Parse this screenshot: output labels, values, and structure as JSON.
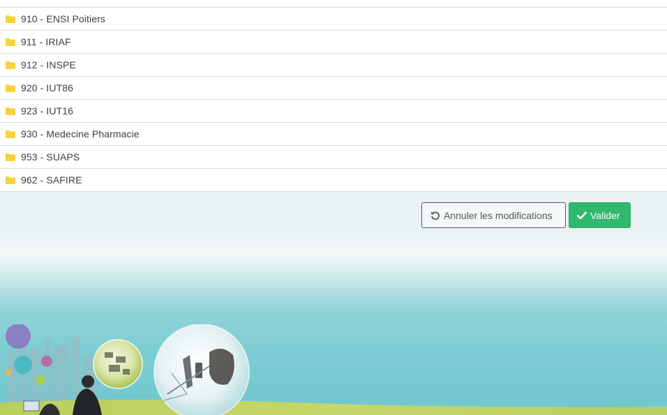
{
  "list": {
    "items": [
      {
        "label": "910 - ENSI Poitiers",
        "icon": "folder-icon"
      },
      {
        "label": "911 - IRIAF",
        "icon": "folder-icon"
      },
      {
        "label": "912 - INSPE",
        "icon": "folder-icon"
      },
      {
        "label": "920 - IUT86",
        "icon": "folder-icon"
      },
      {
        "label": "923 - IUT16",
        "icon": "folder-icon"
      },
      {
        "label": "930 - Medecine Pharmacie",
        "icon": "folder-icon"
      },
      {
        "label": "953 - SUAPS",
        "icon": "folder-icon"
      },
      {
        "label": "962 - SAFIRE",
        "icon": "folder-icon"
      }
    ],
    "folder_color": "#f5d33a"
  },
  "actions": {
    "cancel_label": "Annuler les modifications",
    "cancel_icon": "undo-icon",
    "validate_label": "Valider",
    "validate_icon": "check-icon",
    "validate_color": "#2fb86e"
  }
}
